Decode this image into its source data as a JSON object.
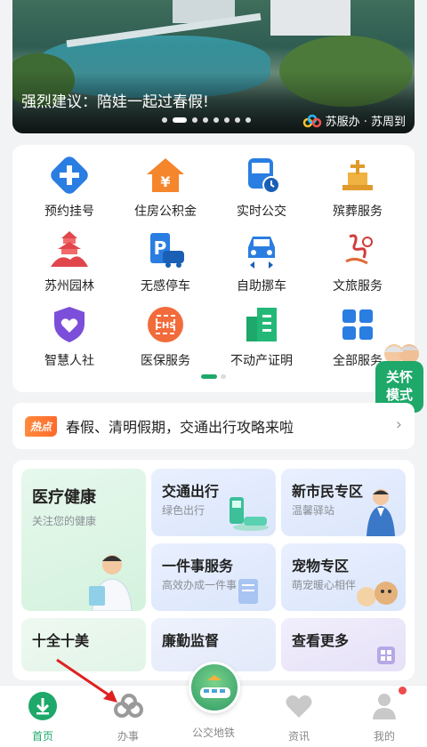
{
  "banner": {
    "title": "强烈建议：陪娃一起过春假!",
    "brand": "苏服办 · 苏周到",
    "dots": 8,
    "active_dot": 1
  },
  "services": [
    {
      "label": "预约挂号",
      "icon": "medical-cross-icon"
    },
    {
      "label": "住房公积金",
      "icon": "house-yuan-icon"
    },
    {
      "label": "实时公交",
      "icon": "bus-clock-icon"
    },
    {
      "label": "殡葬服务",
      "icon": "memorial-icon"
    },
    {
      "label": "苏州园林",
      "icon": "pagoda-icon"
    },
    {
      "label": "无感停车",
      "icon": "parking-icon"
    },
    {
      "label": "自助挪车",
      "icon": "car-move-icon"
    },
    {
      "label": "文旅服务",
      "icon": "culture-icon"
    },
    {
      "label": "智慧人社",
      "icon": "shield-heart-icon"
    },
    {
      "label": "医保服务",
      "icon": "chs-icon"
    },
    {
      "label": "不动产证明",
      "icon": "building-icon"
    },
    {
      "label": "全部服务",
      "icon": "grid-icon"
    }
  ],
  "care_mode": {
    "label_line1": "关怀",
    "label_line2": "模式"
  },
  "hot": {
    "badge": "热点",
    "text": "春假、清明假期，交通出行攻略来啦"
  },
  "categories": {
    "health": {
      "title": "医疗健康",
      "sub": "关注您的健康"
    },
    "transport": {
      "title": "交通出行",
      "sub": "绿色出行"
    },
    "newcitizen": {
      "title": "新市民专区",
      "sub": "温馨驿站"
    },
    "onething": {
      "title": "一件事服务",
      "sub": "高效办成一件事"
    },
    "pet": {
      "title": "宠物专区",
      "sub": "萌宠暖心相伴"
    },
    "tenbeauty": {
      "title": "十全十美"
    },
    "integrity": {
      "title": "廉勤监督"
    },
    "more": {
      "title": "查看更多"
    }
  },
  "tabs": [
    {
      "label": "首页",
      "icon": "home-download-icon",
      "active": true
    },
    {
      "label": "办事",
      "icon": "service-logo-icon",
      "active": false
    },
    {
      "label": "公交地铁",
      "icon": "train-icon",
      "active": false
    },
    {
      "label": "资讯",
      "icon": "heart-icon",
      "active": false
    },
    {
      "label": "我的",
      "icon": "person-icon",
      "active": false
    }
  ],
  "colors": {
    "accent": "#1ea86a",
    "hot": "#ff6a2b",
    "badge_red": "#ef4b4b"
  }
}
